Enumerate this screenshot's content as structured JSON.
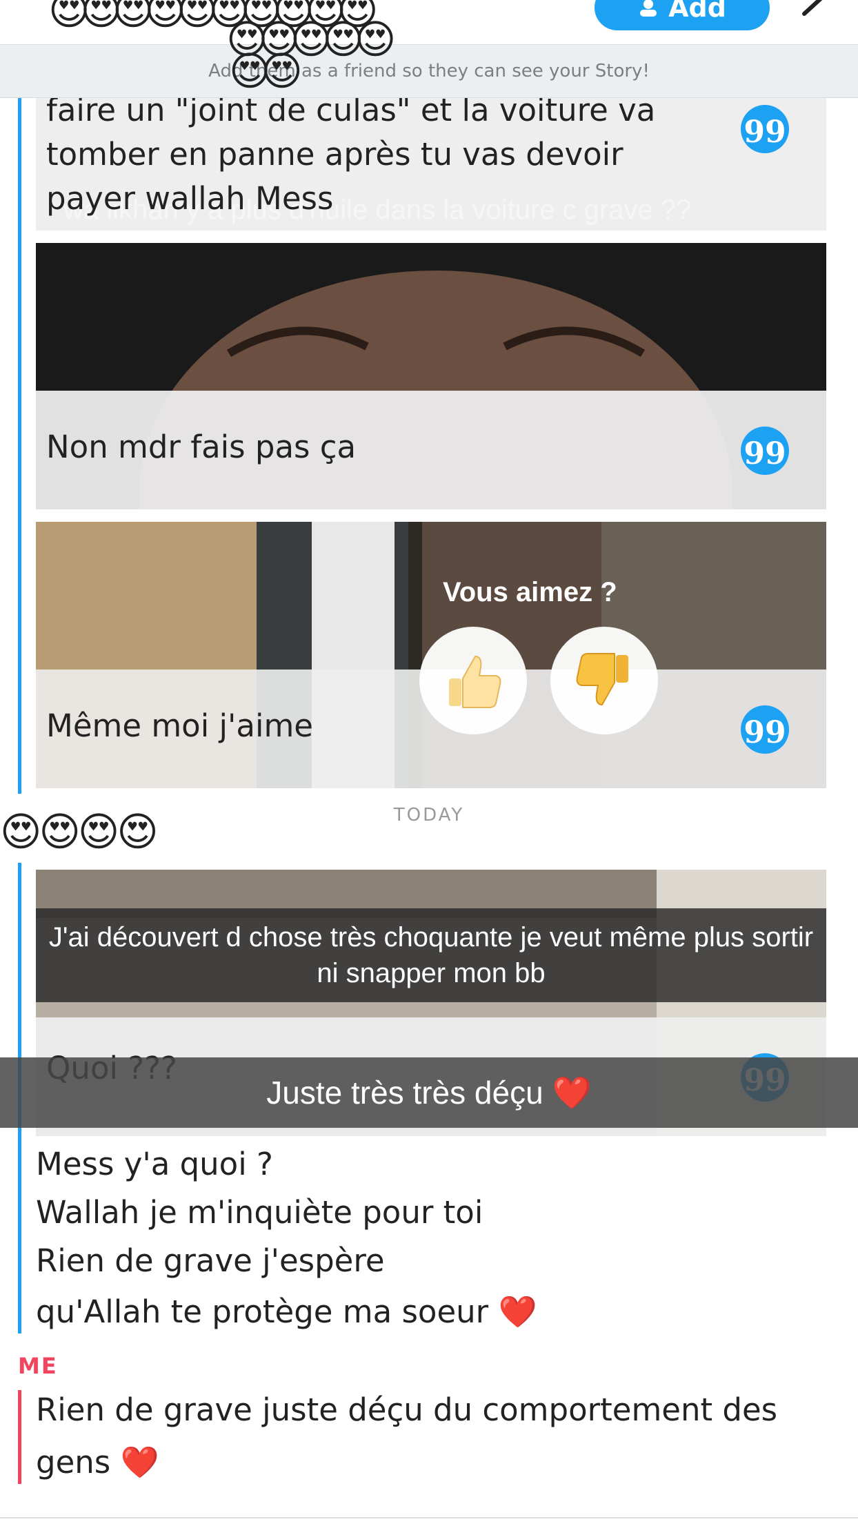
{
  "header": {
    "add_button_label": "Add",
    "notice_text": "Add them as a friend so they can see your Story!",
    "sticker_row_top": "😍😍😍😍😍😍😍😍😍😍",
    "sticker_row_mid": "😍😍😍😍😍",
    "sticker_row_low": "😍😍"
  },
  "messages_partner": [
    {
      "text_lines": [
        "faire un \"joint de culas\" et la voiture va",
        "tomber en panne après tu vas devoir",
        "payer wallah Mess"
      ],
      "snap_caption": "wa likhan y a plus d'huile dans la voiture c grave ??"
    },
    {
      "text": "Non mdr fais pas ça"
    },
    {
      "text": "Même moi j'aime",
      "poll_question": "Vous aimez ?"
    }
  ],
  "today_label": "TODAY",
  "stickers_side": "😍😍😍😍",
  "today_snap": {
    "caption": "J'ai découvert d chose très choquante je veut même plus sortir ni snapper mon bb",
    "reply_text": "Quoi ???"
  },
  "overlay_caption": "Juste très très déçu ❤️",
  "plain_messages": [
    "Mess y'a quoi ?",
    "Wallah je m'inquiète pour toi",
    "Rien de grave j'espère",
    "qu'Allah te protège ma soeur ❤️"
  ],
  "me": {
    "label": "ME",
    "message_lines": [
      "Rien de grave juste déçu du comportement des",
      "gens ❤️"
    ]
  },
  "colors": {
    "blue": "#1da1f2",
    "red": "#f2445e"
  },
  "quote_icon_glyph": "99"
}
